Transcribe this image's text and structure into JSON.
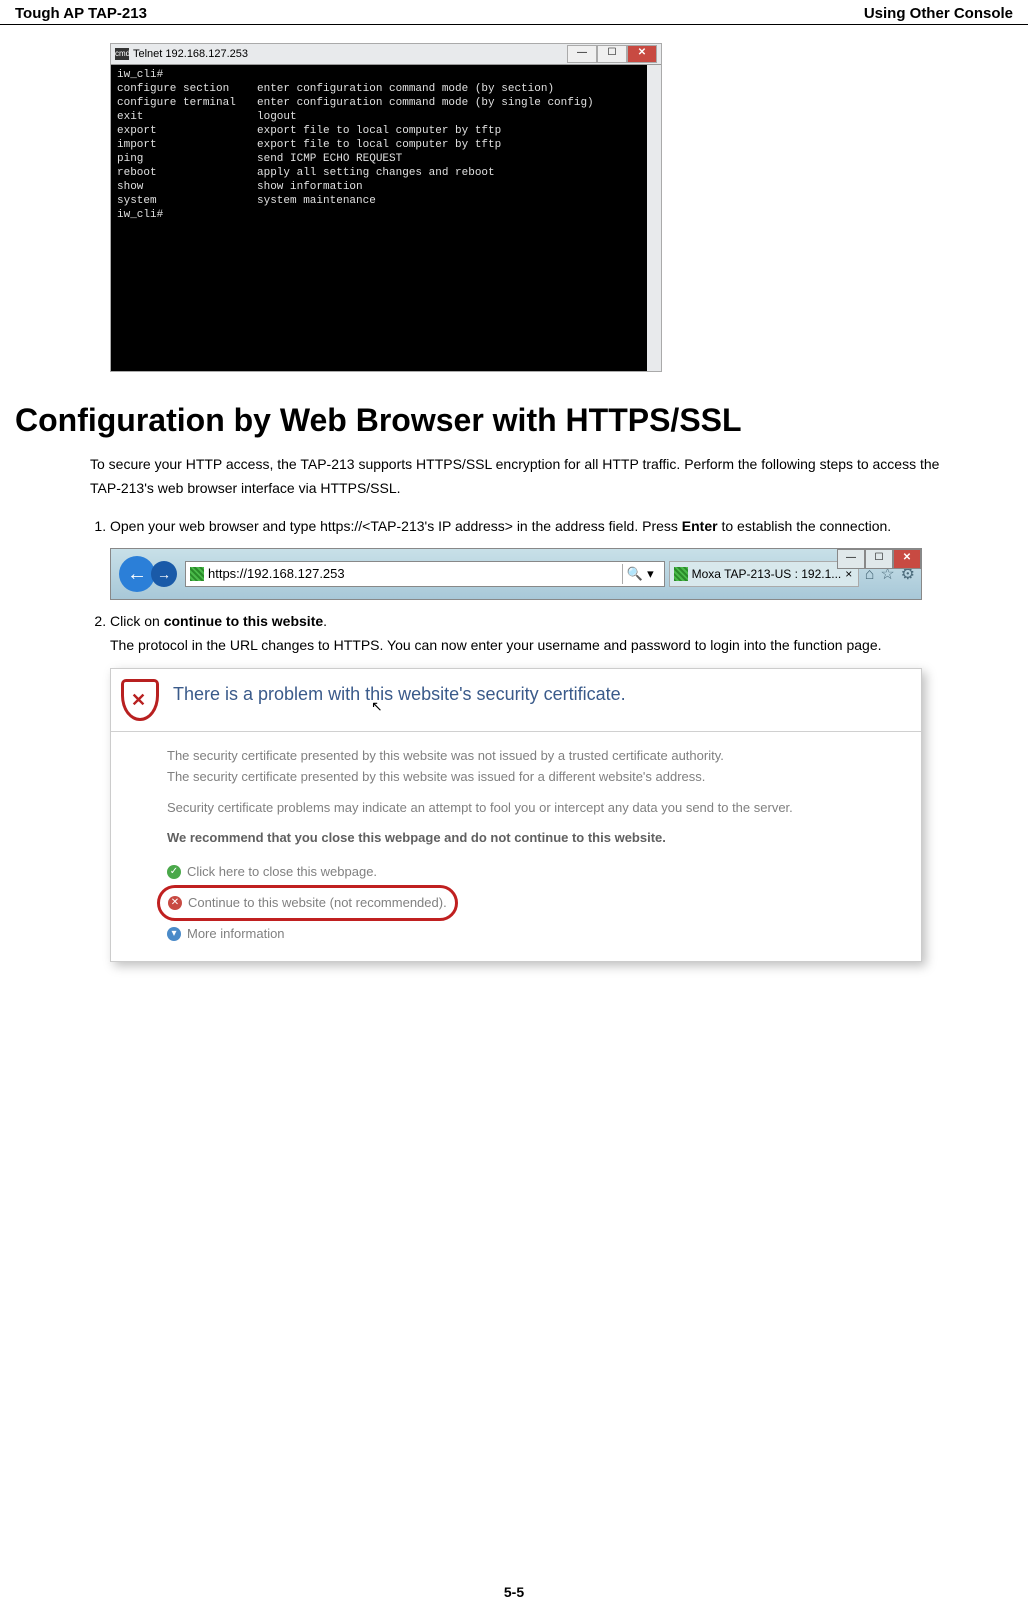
{
  "header": {
    "left": "Tough AP TAP-213",
    "right": "Using Other Console"
  },
  "telnet": {
    "title_prefix": "cmd",
    "title": "Telnet 192.168.127.253",
    "rows": [
      {
        "cmd": "iw_cli#",
        "desc": ""
      },
      {
        "cmd": "configure section",
        "desc": "enter configuration command mode (by section)"
      },
      {
        "cmd": "configure terminal",
        "desc": "enter configuration command mode (by single config)"
      },
      {
        "cmd": "exit",
        "desc": "logout"
      },
      {
        "cmd": "export",
        "desc": "export file to local computer by tftp"
      },
      {
        "cmd": "import",
        "desc": "export file to local computer by tftp"
      },
      {
        "cmd": "ping",
        "desc": "send ICMP ECHO REQUEST"
      },
      {
        "cmd": "reboot",
        "desc": "apply all setting changes and reboot"
      },
      {
        "cmd": "show",
        "desc": "show information"
      },
      {
        "cmd": "system",
        "desc": "system maintenance"
      },
      {
        "cmd": "iw_cli#",
        "desc": ""
      }
    ]
  },
  "section_title": "Configuration by Web Browser with HTTPS/SSL",
  "intro": "To secure your HTTP access, the TAP-213 supports HTTPS/SSL encryption for all HTTP traffic. Perform the following steps to access the TAP-213's web browser interface via HTTPS/SSL.",
  "step1_a": "Open your web browser and type https://<TAP-213's IP address> in the address field. Press ",
  "step1_enter": "Enter",
  "step1_b": " to establish the connection.",
  "browser": {
    "url": "https://192.168.127.253",
    "search_dd": "▾",
    "tab_title": "Moxa TAP-213-US : 192.1...",
    "tab_close": "×",
    "magnify": "🔍"
  },
  "step2_a": "Click on ",
  "step2_link": "continue to this website",
  "step2_b": ".",
  "step2_desc": "The protocol in the URL changes to HTTPS. You can now enter your username and password to login into the function page.",
  "cert": {
    "title": "There is a problem with this website's security certificate.",
    "p1": "The security certificate presented by this website was not issued by a trusted certificate authority.",
    "p2": "The security certificate presented by this website was issued for a different website's address.",
    "p3": "Security certificate problems may indicate an attempt to fool you or intercept any data you send to the server.",
    "p4": "We recommend that you close this webpage and do not continue to this website.",
    "link1": "Click here to close this webpage.",
    "link2": "Continue to this website (not recommended).",
    "link3": "More information"
  },
  "footer": "5-5"
}
